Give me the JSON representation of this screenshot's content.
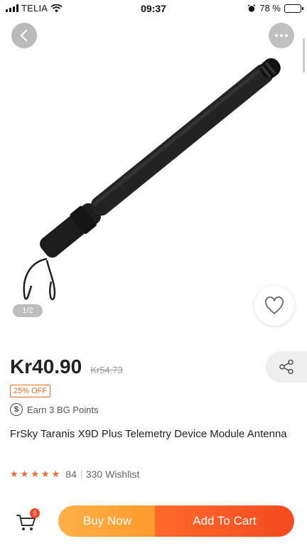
{
  "status_bar": {
    "carrier": "TELIA",
    "time": "09:37",
    "battery": "78 %",
    "battery_level": 0.78
  },
  "gallery": {
    "page_indicator": "1/2",
    "icons": {
      "back": "chevron-left-icon",
      "more": "more-dots-icon",
      "wishlist": "heart-icon"
    }
  },
  "product": {
    "price": "Kr40.90",
    "old_price": "Kr54.73",
    "discount": "25% OFF",
    "points_icon": "$",
    "points": "Earn 3 BG Points",
    "title": "FrSky Taranis X9D Plus Telemetry Device Module Antenna",
    "rating_stars": 5,
    "review_count": "84",
    "wishlist": "330 Wishlist"
  },
  "bottom_bar": {
    "cart_badge": "5",
    "buy_now": "Buy Now",
    "add_to_cart": "Add To Cart"
  },
  "colors": {
    "accent": "#f06a2a",
    "buy_now": "#ffa53a",
    "add_to_cart": "#f5531f"
  }
}
